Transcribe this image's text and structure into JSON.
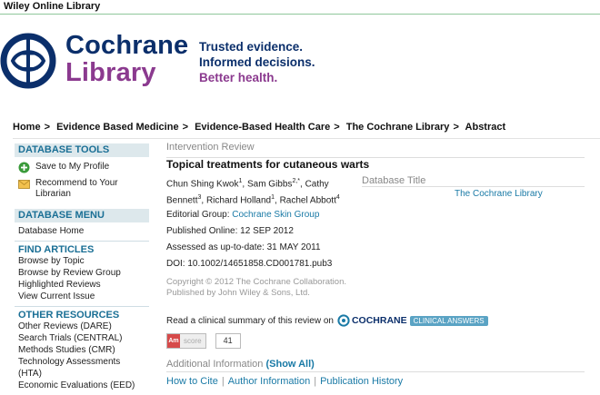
{
  "topbar": {
    "title": "Wiley Online Library"
  },
  "logo": {
    "line1": "Cochrane",
    "line2": "Library",
    "tagline": [
      "Trusted evidence.",
      "Informed decisions.",
      "Better health."
    ]
  },
  "breadcrumb": [
    "Home",
    "Evidence Based Medicine",
    "Evidence-Based Health Care",
    "The Cochrane Library",
    "Abstract"
  ],
  "sidebar": {
    "tools_heading": "DATABASE TOOLS",
    "tools": [
      "Save to My Profile",
      "Recommend to Your Librarian"
    ],
    "menu_heading": "DATABASE MENU",
    "menu_items": [
      "Database Home"
    ],
    "find_heading": "FIND ARTICLES",
    "find_items": [
      "Browse by Topic",
      "Browse by Review Group",
      "Highlighted Reviews",
      "View Current Issue"
    ],
    "other_heading": "OTHER RESOURCES",
    "other_items": [
      "Other Reviews (DARE)",
      "Search Trials (CENTRAL)",
      "Methods Studies (CMR)",
      "Technology Assessments (HTA)",
      "Economic Evaluations (EED)"
    ]
  },
  "article": {
    "kind": "Intervention Review",
    "title": "Topical treatments for cutaneous warts",
    "authors": [
      {
        "name": "Chun Shing Kwok",
        "sup": "1"
      },
      {
        "name": "Sam Gibbs",
        "sup": "2,*"
      },
      {
        "name": "Cathy Bennett",
        "sup": "3"
      },
      {
        "name": "Richard Holland",
        "sup": "1"
      },
      {
        "name": "Rachel Abbott",
        "sup": "4"
      }
    ],
    "database_title_label": "Database Title",
    "database_title_value": "The Cochrane Library",
    "editorial_label": "Editorial Group:",
    "editorial_group": "Cochrane Skin Group",
    "published": "Published Online: 12 SEP 2012",
    "assessed": "Assessed as up-to-date: 31 MAY 2011",
    "doi": "DOI: 10.1002/14651858.CD001781.pub3",
    "copyright_1": "Copyright © 2012 The Cochrane Collaboration.",
    "copyright_2": "Published by John Wiley & Sons, Ltd.",
    "summary_text": "Read a clinical summary of this review on",
    "cca_name": "COCHRANE",
    "cca_badge": "CLINICAL ANSWERS",
    "altmetric_logo": "Am",
    "altmetric_label": "score",
    "altmetric_score": "41",
    "additional_label": "Additional Information",
    "show_all": "(Show All)",
    "links": [
      "How to Cite",
      "Author Information",
      "Publication History"
    ]
  },
  "colors": {
    "brand_blue": "#0b2f6b",
    "brand_purple": "#8b3a8f",
    "link": "#1a7aa6",
    "sidebar_head_bg": "#dde8ec"
  }
}
